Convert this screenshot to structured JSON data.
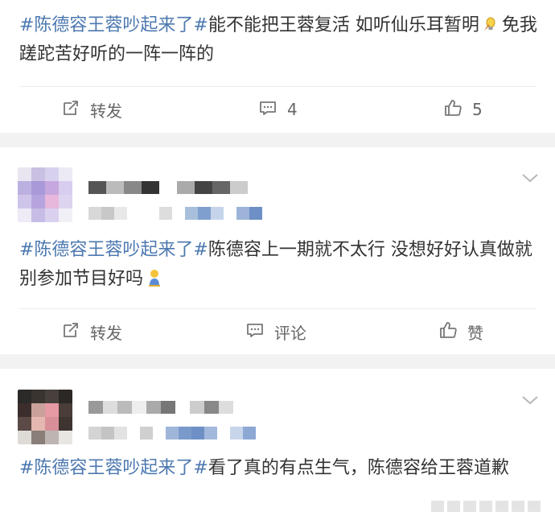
{
  "posts": [
    {
      "topic": "#陈德容王蓉吵起来了#",
      "text_before_emoji": "能不能把王蓉复活 如听仙乐耳暂明",
      "emoji": "light-bulb-emoji",
      "text_after_emoji": "免我蹉跎苦好听的一阵一阵的",
      "actions": {
        "repost_label": "转发",
        "comment_label": "4",
        "like_label": "5"
      }
    },
    {
      "topic": "#陈德容王蓉吵起来了#",
      "text_before_emoji": "陈德容上一期就不太行 没想好好认真做就别参加节目好吗",
      "emoji": "kneeling-figure-emoji",
      "actions": {
        "repost_label": "转发",
        "comment_label": "评论",
        "like_label": "赞"
      }
    },
    {
      "topic": "#陈德容王蓉吵起来了#",
      "text_before_emoji": "看了真的有点生气，陈德容给王蓉道歉"
    }
  ],
  "colors": {
    "topic": "#4c78b0",
    "text": "#333333",
    "action": "#666666",
    "page_bg": "#f2f2f2"
  },
  "icons": [
    "share-icon",
    "comment-icon",
    "thumbs-up-icon",
    "chevron-down-icon"
  ]
}
